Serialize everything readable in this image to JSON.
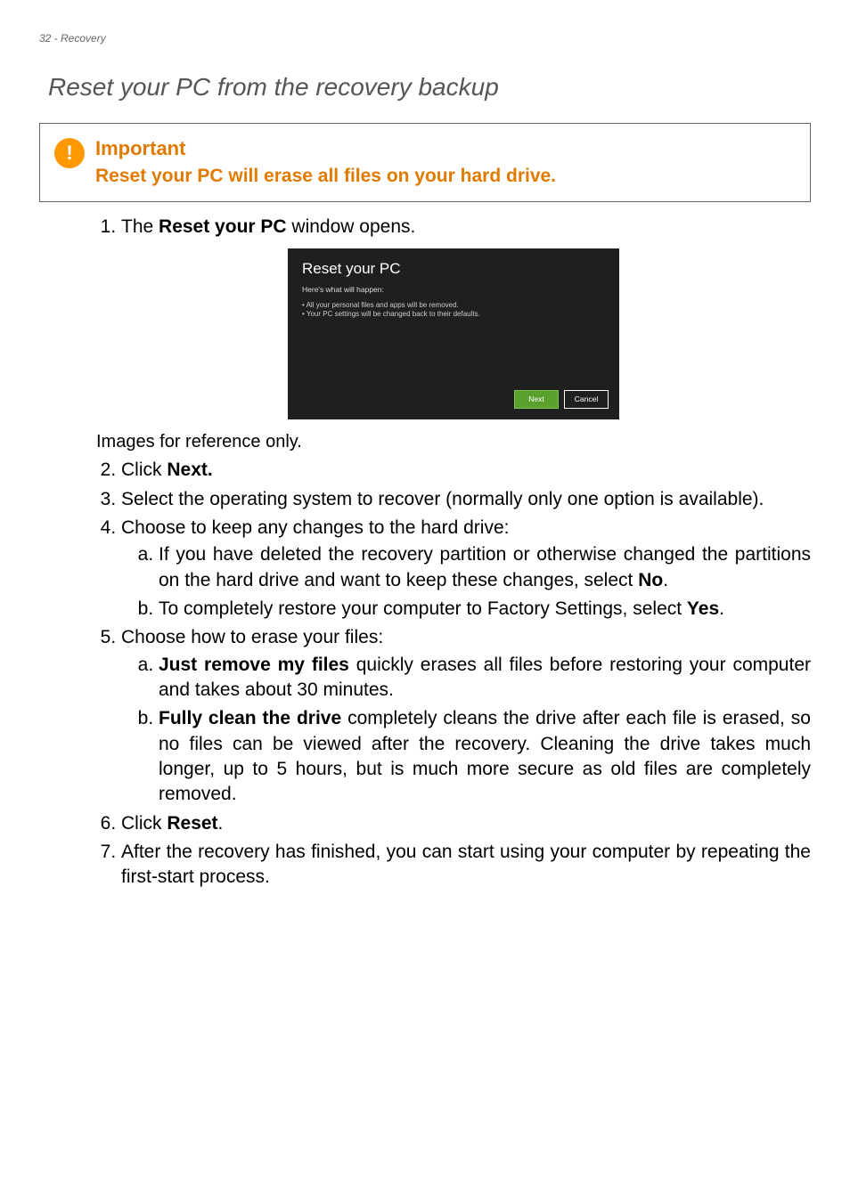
{
  "header": {
    "text": "32 - Recovery"
  },
  "title": "Reset your PC from the recovery backup",
  "callout": {
    "title": "Important",
    "body": "Reset your PC will erase all files on your hard drive."
  },
  "dialog": {
    "title": "Reset your PC",
    "subtitle": "Here's what will happen:",
    "bullet1": "• All your personal files and apps will be removed.",
    "bullet2": "• Your PC settings will be changed back to their defaults.",
    "next": "Next",
    "cancel": "Cancel"
  },
  "steps": {
    "s1_prefix": "The ",
    "s1_bold": "Reset your PC",
    "s1_suffix": " window opens.",
    "ref_note": "Images for reference only.",
    "s2_prefix": "Click ",
    "s2_bold": "Next.",
    "s3": "Select the operating system to recover (normally only one option is available).",
    "s4": "Choose to keep any changes to the hard drive:",
    "s4a_prefix": "If you have deleted the recovery partition or otherwise changed the partitions on the hard drive and want to keep these changes, select ",
    "s4a_bold": "No",
    "s4a_suffix": ".",
    "s4b_prefix": "To completely restore your computer to Factory Settings, select ",
    "s4b_bold": "Yes",
    "s4b_suffix": ".",
    "s5": "Choose how to erase your files:",
    "s5a_bold": "Just remove my files",
    "s5a_suffix": " quickly erases all files before restoring your computer and takes about 30 minutes.",
    "s5b_bold": "Fully clean the drive",
    "s5b_suffix": " completely cleans the drive after each file is erased, so no files can be viewed after the recovery. Cleaning the drive takes much longer, up to 5 hours, but is much more secure as old files are completely removed.",
    "s6_prefix": "Click ",
    "s6_bold": "Reset",
    "s6_suffix": ".",
    "s7": "After the recovery has finished, you can start using your computer by repeating the first-start process."
  }
}
